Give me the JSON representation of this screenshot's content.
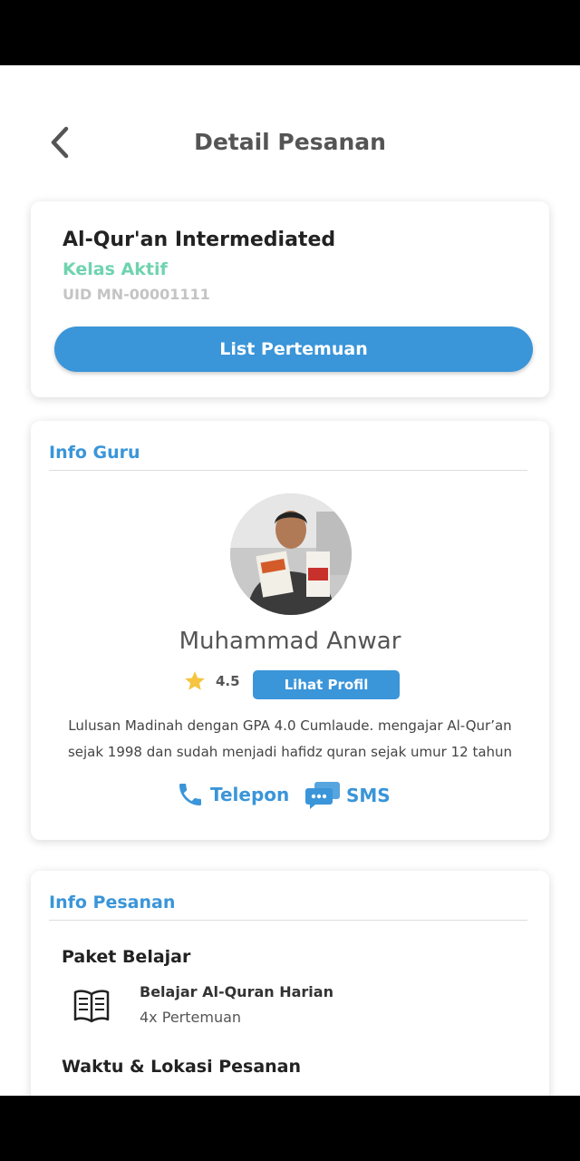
{
  "header": {
    "title": "Detail Pesanan"
  },
  "course": {
    "title": "Al-Qur'an Intermediated",
    "status": "Kelas Aktif",
    "uid": "UID MN-00001111",
    "action_label": "List Pertemuan"
  },
  "teacher_section": {
    "title": "Info Guru",
    "name": "Muhammad Anwar",
    "rating": "4.5",
    "profile_button": "Lihat Profil",
    "bio": "Lulusan Madinah dengan GPA 4.0 Cumlaude. mengajar Al-Qur’an sejak 1998 dan sudah menjadi hafidz quran sejak umur 12 tahun",
    "contacts": [
      {
        "label": "Telepon",
        "icon": "phone-icon"
      },
      {
        "label": "SMS",
        "icon": "chat-icon"
      }
    ]
  },
  "order_section": {
    "title": "Info Pesanan",
    "package_heading": "Paket Belajar",
    "package": {
      "icon": "book-icon",
      "name": "Belajar Al-Quran Harian",
      "sessions": "4x Pertemuan"
    },
    "schedule_heading": "Waktu & Lokasi Pesanan"
  },
  "colors": {
    "accent": "#3a95d9",
    "active_status": "#6fd3b0",
    "muted": "#c4c4c4"
  }
}
